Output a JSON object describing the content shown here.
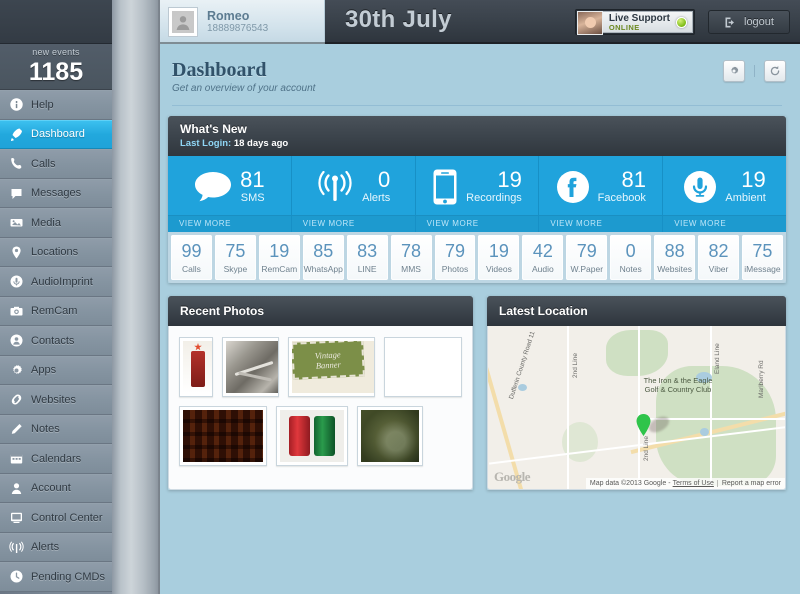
{
  "sidebar": {
    "events_label": "new events",
    "events_count": "1185",
    "items": [
      {
        "label": "Help",
        "icon": "info-icon"
      },
      {
        "label": "Dashboard",
        "icon": "dashboard-icon"
      },
      {
        "label": "Calls",
        "icon": "phone-icon"
      },
      {
        "label": "Messages",
        "icon": "message-icon"
      },
      {
        "label": "Media",
        "icon": "media-icon"
      },
      {
        "label": "Locations",
        "icon": "pin-icon"
      },
      {
        "label": "AudioImprint",
        "icon": "mic-icon"
      },
      {
        "label": "RemCam",
        "icon": "camera-icon"
      },
      {
        "label": "Contacts",
        "icon": "contacts-icon"
      },
      {
        "label": "Apps",
        "icon": "gear-icon"
      },
      {
        "label": "Websites",
        "icon": "link-icon"
      },
      {
        "label": "Notes",
        "icon": "pen-icon"
      },
      {
        "label": "Calendars",
        "icon": "calendar-icon"
      },
      {
        "label": "Account",
        "icon": "user-icon"
      },
      {
        "label": "Control Center",
        "icon": "monitor-icon"
      },
      {
        "label": "Alerts",
        "icon": "signal-icon"
      },
      {
        "label": "Pending CMDs",
        "icon": "clock-icon"
      }
    ]
  },
  "topbar": {
    "profile_name": "Romeo",
    "profile_phone": "18889876543",
    "avatar_icon": "user-avatar-icon",
    "date": "30th July",
    "live_support_title": "Live Support",
    "live_support_status": "ONLINE",
    "logout_label": "logout",
    "logout_icon": "logout-icon"
  },
  "page": {
    "title": "Dashboard",
    "subtitle": "Get an overview of your account",
    "settings_icon": "gear-icon",
    "refresh_icon": "refresh-icon"
  },
  "whats_new": {
    "title": "What's New",
    "last_login_label": "Last Login:",
    "last_login_value": "18 days ago",
    "view_more_label": "VIEW MORE",
    "tiles": [
      {
        "value": "81",
        "label": "SMS",
        "icon": "speech-bubble-icon"
      },
      {
        "value": "0",
        "label": "Alerts",
        "icon": "antenna-icon"
      },
      {
        "value": "19",
        "label": "Recordings",
        "icon": "smartphone-icon"
      },
      {
        "value": "81",
        "label": "Facebook",
        "icon": "facebook-icon"
      },
      {
        "value": "19",
        "label": "Ambient",
        "icon": "microphone-icon"
      }
    ]
  },
  "counters": [
    {
      "value": "99",
      "label": "Calls"
    },
    {
      "value": "75",
      "label": "Skype"
    },
    {
      "value": "19",
      "label": "RemCam"
    },
    {
      "value": "85",
      "label": "WhatsApp"
    },
    {
      "value": "83",
      "label": "LINE"
    },
    {
      "value": "78",
      "label": "MMS"
    },
    {
      "value": "79",
      "label": "Photos"
    },
    {
      "value": "19",
      "label": "Videos"
    },
    {
      "value": "42",
      "label": "Audio"
    },
    {
      "value": "79",
      "label": "W.Paper"
    },
    {
      "value": "0",
      "label": "Notes"
    },
    {
      "value": "88",
      "label": "Websites"
    },
    {
      "value": "82",
      "label": "Viber"
    },
    {
      "value": "75",
      "label": "iMessage"
    }
  ],
  "recent_photos": {
    "title": "Recent Photos",
    "items": [
      {
        "name": "vintage-gas-pump-photo"
      },
      {
        "name": "grayscale-tools-photo"
      },
      {
        "name": "vintage-banner-photo",
        "caption_line1": "Vintage",
        "caption_line2": "Banner"
      },
      {
        "name": "pop-art-grid-photo"
      },
      {
        "name": "shelf-bottles-photo"
      },
      {
        "name": "soda-cans-photo"
      },
      {
        "name": "ornaments-photo"
      }
    ]
  },
  "latest_location": {
    "title": "Latest Location",
    "poi_label": "The Iron & the Eagle Golf & Country Club",
    "road_labels": [
      "2nd Line",
      "2nd Line",
      "Dufferin County Road 11",
      "Eland Line",
      "Marlberry Rd"
    ],
    "google_watermark": "Google",
    "attribution": "Map data ©2013 Google",
    "terms_label": "Terms of Use",
    "report_label": "Report a map error",
    "pin_color": "#2fc44a"
  },
  "colors": {
    "accent_blue": "#20a3dc",
    "page_bg": "#a9cede",
    "panel_dark": "#3c444c",
    "counter_value": "#5b93bc"
  }
}
